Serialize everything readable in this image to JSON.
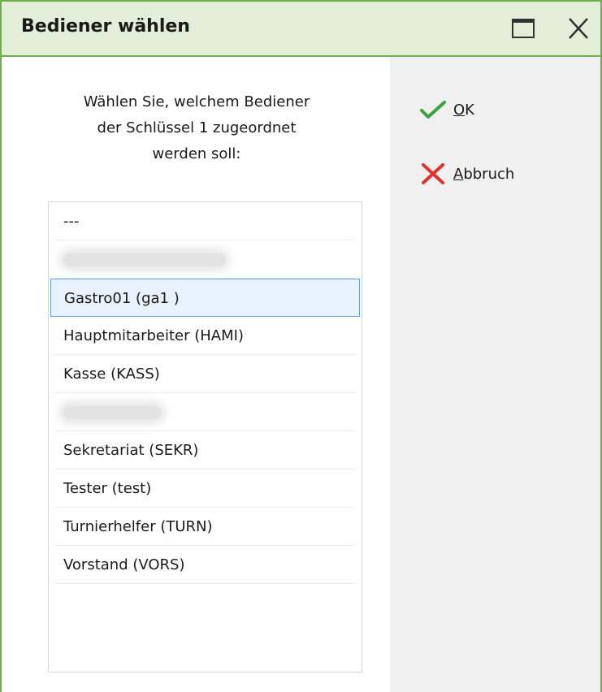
{
  "window": {
    "title": "Bediener wählen"
  },
  "prompt": {
    "lines": [
      "Wählen Sie, welchem Bediener",
      "der Schlüssel 1 zugeordnet",
      "werden soll:"
    ]
  },
  "list": {
    "items": [
      {
        "label": "---"
      },
      {
        "label": "",
        "redacted": true
      },
      {
        "label": "Gastro01 (ga1 )",
        "selected": true
      },
      {
        "label": "Hauptmitarbeiter (HAMI)"
      },
      {
        "label": "Kasse (KASS)"
      },
      {
        "label": "",
        "redacted": true
      },
      {
        "label": "Sekretariat (SEKR)"
      },
      {
        "label": "Tester (test)"
      },
      {
        "label": "Turnierhelfer (TURN)"
      },
      {
        "label": "Vorstand (VORS)"
      }
    ]
  },
  "actions": {
    "ok": {
      "mnemonic": "O",
      "rest": "K",
      "icon": "check-icon",
      "color": "#3aa13a"
    },
    "cancel": {
      "mnemonic": "A",
      "rest": "bbruch",
      "icon": "cross-icon",
      "color": "#e0342a"
    }
  },
  "colors": {
    "accent": "#6cb04a",
    "titlebar": "#e3efd9",
    "selection_border": "#5b9fdf",
    "selection_bg": "#e8f2fc"
  }
}
